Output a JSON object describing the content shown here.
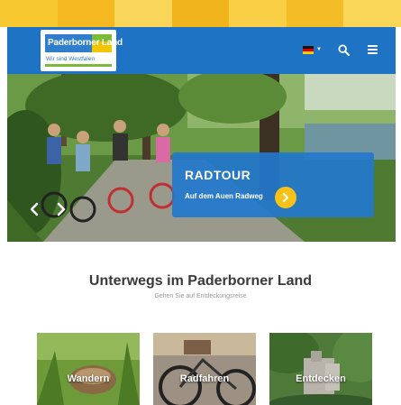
{
  "colors": {
    "stripe": [
      "#f7c830",
      "#f5b820",
      "#f9d65a",
      "#f2b41c",
      "#f8cf45",
      "#f4bc26",
      "#f9d558"
    ],
    "header_blue": "#1f73c5",
    "accent_yellow": "#f7c318",
    "logo_green": "#7cbb3a"
  },
  "header": {
    "logo": {
      "name": "Paderborner Land",
      "tagline": "Wir sind Westfalen"
    },
    "language_icon": "german-flag-icon",
    "search_icon": "search-icon",
    "menu_icon": "hamburger-menu-icon"
  },
  "hero": {
    "title": "RADTOUR",
    "subtitle": "Auf dem Auen Radweg",
    "prev_icon": "chevron-left-icon",
    "next_icon": "chevron-right-icon",
    "cta_icon": "chevron-right-icon"
  },
  "section": {
    "title": "Unterwegs im Paderborner Land",
    "subtitle": "Gehen Sie auf Entdeckungsreise"
  },
  "tiles": [
    {
      "label": "Wandern"
    },
    {
      "label": "Radfahren"
    },
    {
      "label": "Entdecken"
    }
  ]
}
